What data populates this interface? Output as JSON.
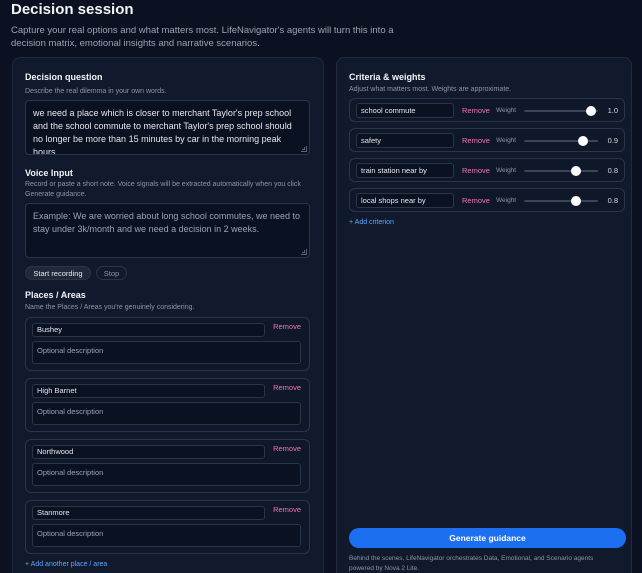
{
  "page": {
    "title": "Decision session",
    "intro": "Capture your real options and what matters most. LifeNavigator's agents will turn this into a decision matrix, emotional insights and narrative scenarios."
  },
  "decision": {
    "title": "Decision question",
    "hint": "Describe the real dilemma in your own words.",
    "value": "we need a place which is closer to merchant Taylor's prep school and the school commute to merchant Taylor's prep school should no longer be more than 15 minutes by car in the morning peak hours."
  },
  "voice": {
    "title": "Voice Input",
    "hint": "Record or paste a short note. Voice signals will be extracted automatically when you click Generate guidance.",
    "placeholder": "Example: We are worried about long school commutes, we need to stay under 3k/month and we need a decision in 2 weeks.",
    "start_label": "Start recording",
    "stop_label": "Stop"
  },
  "places": {
    "title": "Places / Areas",
    "hint": "Name the Places / Areas you're genuinely considering.",
    "remove_label": "Remove",
    "desc_placeholder": "Optional description",
    "items": [
      {
        "name": "Bushey"
      },
      {
        "name": "High Barnet"
      },
      {
        "name": "Northwood"
      },
      {
        "name": "Stanmore"
      }
    ],
    "add_label": "+ Add another place / area"
  },
  "criteria": {
    "title": "Criteria & weights",
    "hint": "Adjust what matters most. Weights are approximate.",
    "remove_label": "Remove",
    "weight_label": "Weight",
    "items": [
      {
        "name": "school commute",
        "weight": "1.0",
        "fraction": 1.0
      },
      {
        "name": "safety",
        "weight": "0.9",
        "fraction": 0.9
      },
      {
        "name": "train station near by",
        "weight": "0.8",
        "fraction": 0.8
      },
      {
        "name": "local shops near by",
        "weight": "0.8",
        "fraction": 0.8
      }
    ],
    "add_label": "+ Add criterion"
  },
  "actions": {
    "generate_label": "Generate guidance",
    "footnote": "Behind the scenes, LifeNavigator orchestrates Data, Emotional, and Scenario agents powered by Nova 2 Lite."
  }
}
